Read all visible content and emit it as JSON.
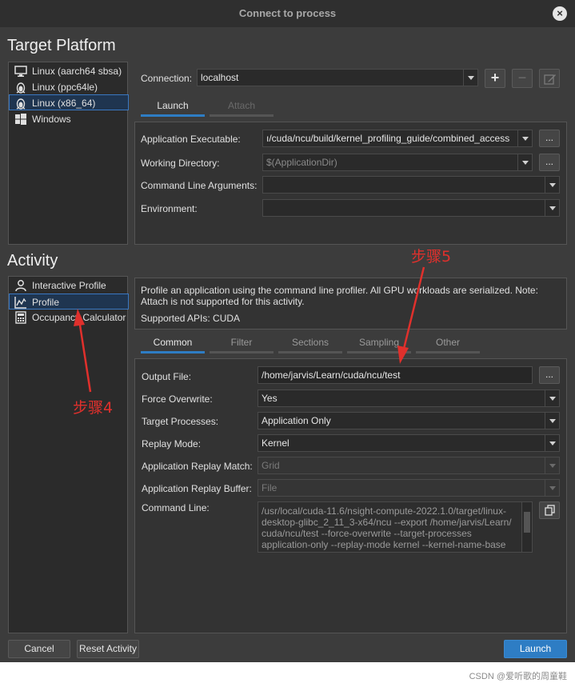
{
  "window": {
    "title": "Connect to process"
  },
  "target_platform": {
    "heading": "Target Platform",
    "items": [
      {
        "label": "Linux (aarch64 sbsa)",
        "icon": "monitor-icon"
      },
      {
        "label": "Linux (ppc64le)",
        "icon": "linux-tux-icon"
      },
      {
        "label": "Linux (x86_64)",
        "icon": "linux-tux-icon",
        "selected": true
      },
      {
        "label": "Windows",
        "icon": "windows-logo-icon"
      }
    ]
  },
  "connection": {
    "label": "Connection:",
    "value": "localhost",
    "add": "+",
    "remove": "−"
  },
  "launch_tabs": [
    {
      "label": "Launch",
      "state": "active"
    },
    {
      "label": "Attach",
      "state": "disabled"
    }
  ],
  "launch": {
    "app_exe_label": "Application Executable:",
    "app_exe_value": "ı/cuda/ncu/build/kernel_profiling_guide/combined_access",
    "workdir_label": "Working Directory:",
    "workdir_value": "$(ApplicationDir)",
    "args_label": "Command Line Arguments:",
    "args_value": "",
    "env_label": "Environment:",
    "env_value": "",
    "browse": "..."
  },
  "activity": {
    "heading": "Activity",
    "items": [
      {
        "label": "Interactive Profile",
        "icon": "user-icon"
      },
      {
        "label": "Profile",
        "icon": "chart-icon",
        "selected": true
      },
      {
        "label": "Occupancy Calculator",
        "icon": "calculator-icon"
      }
    ],
    "description": "Profile an application using the command line profiler. All GPU workloads are serialized. Note: Attach is not supported for this activity.",
    "supported_apis": "Supported APIs: CUDA"
  },
  "profile_tabs": [
    {
      "label": "Common",
      "state": "active"
    },
    {
      "label": "Filter",
      "state": "normal"
    },
    {
      "label": "Sections",
      "state": "normal"
    },
    {
      "label": "Sampling",
      "state": "normal"
    },
    {
      "label": "Other",
      "state": "normal"
    }
  ],
  "common": {
    "output_file_label": "Output File:",
    "output_file_value": "/home/jarvis/Learn/cuda/ncu/test",
    "force_overwrite_label": "Force Overwrite:",
    "force_overwrite_value": "Yes",
    "target_processes_label": "Target Processes:",
    "target_processes_value": "Application Only",
    "replay_mode_label": "Replay Mode:",
    "replay_mode_value": "Kernel",
    "app_replay_match_label": "Application Replay Match:",
    "app_replay_match_value": "Grid",
    "app_replay_buffer_label": "Application Replay Buffer:",
    "app_replay_buffer_value": "File",
    "command_line_label": "Command Line:",
    "command_line_lines": [
      "/usr/local/cuda-11.6/nsight-compute-2022.1.0/target/linux-",
      "desktop-glibc_2_11_3-x64/ncu --export /home/jarvis/Learn/",
      "cuda/ncu/test --force-overwrite --target-processes",
      "application-only --replay-mode kernel --kernel-name-base"
    ]
  },
  "footer": {
    "cancel": "Cancel",
    "reset": "Reset Activity",
    "launch": "Launch"
  },
  "annotations": {
    "step4": "步骤4",
    "step5": "步骤5",
    "color": "#e0302c"
  },
  "watermark": "CSDN @爱听歌的周童鞋"
}
